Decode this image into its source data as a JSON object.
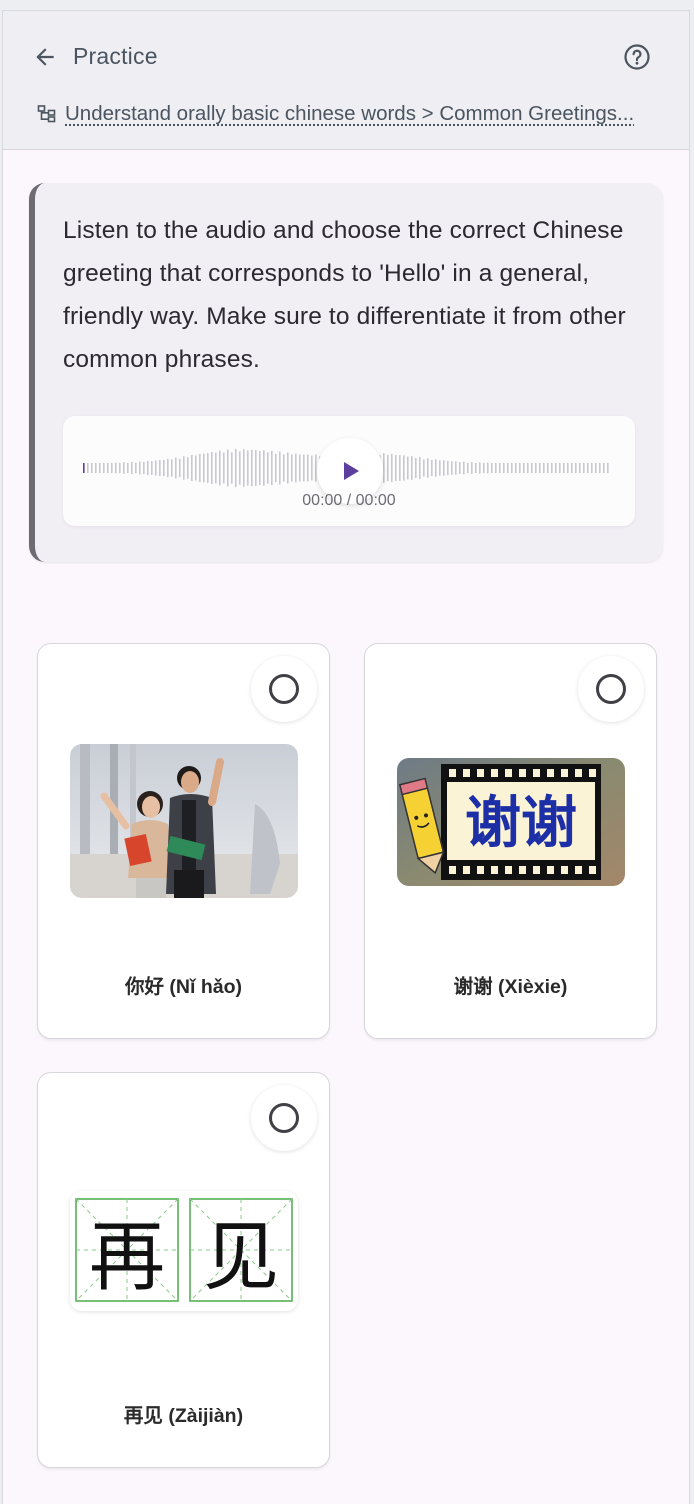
{
  "header": {
    "title": "Practice",
    "breadcrumb": "Understand orally basic chinese words > Common Greetings..."
  },
  "question": {
    "text": "Listen to the audio and choose the correct Chinese greeting that corresponds to 'Hello' in a general, friendly way. Make sure to differentiate it from other common phrases."
  },
  "audio": {
    "time": "00:00 / 00:00",
    "progress": 0,
    "accent_color": "#5b3e9e"
  },
  "options": [
    {
      "label": "你好 (Nǐ hǎo)"
    },
    {
      "label": "谢谢 (Xièxie)",
      "image_text": "谢谢"
    },
    {
      "label": "再见 (Zàijiàn)",
      "image_text_1": "再",
      "image_text_2": "见"
    }
  ],
  "icons": {
    "back": "arrow-left-icon",
    "help": "help-circle-icon",
    "breadcrumb": "hierarchy-icon",
    "play": "play-icon"
  }
}
